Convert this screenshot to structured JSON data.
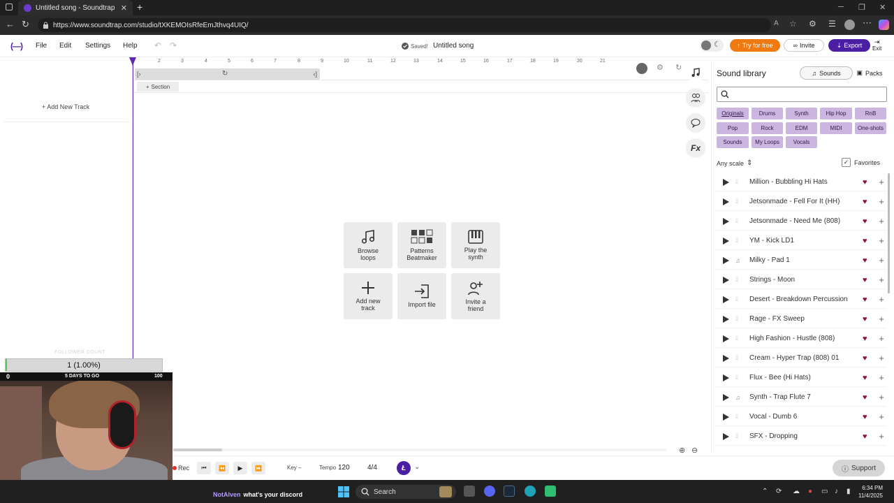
{
  "browser": {
    "tab_title": "Untitled song - Soundtrap",
    "url": "https://www.soundtrap.com/studio/tXKEMOIsRfeEmJthvq4UIQ/"
  },
  "header": {
    "logo": "(—)",
    "menu": [
      "File",
      "Edit",
      "Settings",
      "Help"
    ],
    "saved": "Saved!",
    "song_title": "Untitled song",
    "try_free": "Try for free",
    "invite": "Invite",
    "export": "Export",
    "exit": "Exit"
  },
  "tracks": {
    "add_new_track": "Add New Track",
    "section": "Section"
  },
  "ruler": [
    "2",
    "3",
    "4",
    "5",
    "6",
    "7",
    "8",
    "9",
    "10",
    "11",
    "12",
    "13",
    "14",
    "15",
    "16",
    "17",
    "18",
    "19",
    "20",
    "21"
  ],
  "actions": [
    {
      "label": "Browse\nloops",
      "icon": "music-note-icon"
    },
    {
      "label": "Patterns\nBeatmaker",
      "icon": "grid-icon"
    },
    {
      "label": "Play the\nsynth",
      "icon": "piano-icon"
    },
    {
      "label": "Add new\ntrack",
      "icon": "plus-icon"
    },
    {
      "label": "Import file",
      "icon": "import-icon"
    },
    {
      "label": "Invite a\nfriend",
      "icon": "add-user-icon"
    }
  ],
  "library": {
    "title": "Sound library",
    "tab_sounds": "Sounds",
    "tab_packs": "Packs",
    "search_placeholder": "",
    "categories": [
      "Originals",
      "Drums",
      "Synth",
      "Hip Hop",
      "RnB",
      "Pop",
      "Rock",
      "EDM",
      "MIDI",
      "One-shots",
      "Sounds",
      "My Loops",
      "Vocals"
    ],
    "scale": "Any scale",
    "favorites": "Favorites",
    "sounds": [
      {
        "name": "Million - Bubbling Hi Hats",
        "type": "audio"
      },
      {
        "name": "Jetsonmade - Fell For It (HH)",
        "type": "audio"
      },
      {
        "name": "Jetsonmade - Need Me (808)",
        "type": "audio"
      },
      {
        "name": "YM - Kick LD1",
        "type": "audio"
      },
      {
        "name": "Milky - Pad 1",
        "type": "midi"
      },
      {
        "name": "Strings - Moon",
        "type": "audio"
      },
      {
        "name": "Desert - Breakdown Percussion",
        "type": "audio"
      },
      {
        "name": "Rage - FX Sweep",
        "type": "audio"
      },
      {
        "name": "High Fashion - Hustle (808)",
        "type": "audio"
      },
      {
        "name": "Cream - Hyper Trap (808) 01",
        "type": "audio"
      },
      {
        "name": "Flux - Bee (Hi Hats)",
        "type": "audio"
      },
      {
        "name": "Synth - Trap Flute 7",
        "type": "midi"
      },
      {
        "name": "Vocal - Dumb 6",
        "type": "audio"
      },
      {
        "name": "SFX - Dropping",
        "type": "audio"
      }
    ]
  },
  "transport": {
    "rec": "Rec",
    "key_label": "Key –",
    "tempo_label": "Tempo",
    "tempo": "120",
    "time_signature": "4/4",
    "support": "Support"
  },
  "overlay": {
    "follower_label": "FOLLOWER COUNT",
    "goal_text": "1 (1.00%)",
    "goal_fraction": 0.01,
    "left_count": "0",
    "days": "5 DAYS TO GO",
    "right_count": "100"
  },
  "taskbar": {
    "chat_user": "NotAlven",
    "chat_message": "what's your discord",
    "search": "Search",
    "time": "6:34 PM",
    "date": "11/4/2025"
  },
  "colors": {
    "accent": "#4b1fa3",
    "try_free": "#f07a12",
    "chip": "#cbb6e0",
    "heart": "#8b1538"
  }
}
